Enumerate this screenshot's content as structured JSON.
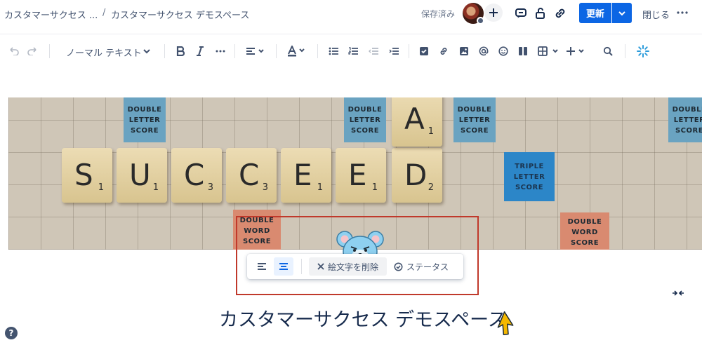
{
  "breadcrumb": {
    "space": "カスタマーサクセス ...",
    "separator": "/",
    "page": "カスタマーサクセス デモスペース"
  },
  "header": {
    "saved_label": "保存済み",
    "update_label": "更新",
    "close_label": "閉じる"
  },
  "toolbar": {
    "text_style": "ノーマル テキスト"
  },
  "banner": {
    "premium_squares": [
      {
        "kind": "dl",
        "text": "DOUBLE\nLETTER\nSCORE"
      },
      {
        "kind": "dl",
        "text": "DOUBLE\nLETTER\nSCORE"
      },
      {
        "kind": "dl",
        "text": "DOUBLE\nLETTER\nSCORE"
      },
      {
        "kind": "dl",
        "text": "DOUBLE\nLETTER\nSCORE"
      },
      {
        "kind": "tl",
        "text": "TRIPLE\nLETTER\nSCORE"
      },
      {
        "kind": "dw",
        "text": "DOUBLE\nWORD\nSCORE"
      },
      {
        "kind": "dw",
        "text": "DOUBLE\nWORD\nSCORE"
      }
    ],
    "tiles": [
      {
        "letter": "S",
        "points": "1"
      },
      {
        "letter": "U",
        "points": "1"
      },
      {
        "letter": "C",
        "points": "3"
      },
      {
        "letter": "C",
        "points": "3"
      },
      {
        "letter": "E",
        "points": "1"
      },
      {
        "letter": "E",
        "points": "1"
      },
      {
        "letter": "D",
        "points": "2"
      },
      {
        "letter": "A",
        "points": "1"
      }
    ]
  },
  "emoji_toolbar": {
    "remove_emoji_label": "絵文字を削除",
    "status_label": "ステータス"
  },
  "page_title": "カスタマーサクセス デモスペース",
  "help_label": "?",
  "colors": {
    "primary": "#0c66e4",
    "highlight_box": "#c0392b",
    "cursor_arrow": "#f5b800"
  }
}
